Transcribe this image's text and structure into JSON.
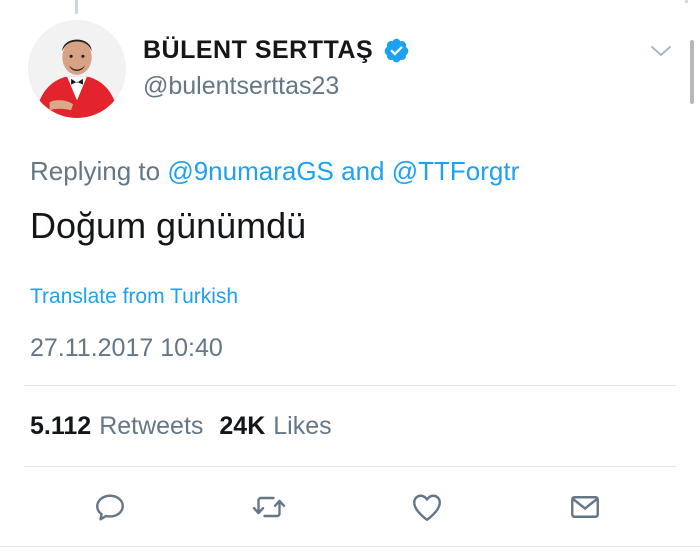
{
  "tweet": {
    "author": {
      "display_name": "BÜLENT SERTTAŞ",
      "handle": "@bulentserttas23",
      "verified": true,
      "avatar_icon": "profile-photo"
    },
    "replying_prefix": "Replying to",
    "reply_mentions": [
      "@9numaraGS",
      "@TTForgtr"
    ],
    "reply_joiner": "and",
    "text": "Doğum günümdü",
    "translate_label": "Translate from Turkish",
    "timestamp": "27.11.2017 10:40",
    "stats": {
      "retweets_count": "5.112",
      "retweets_label": "Retweets",
      "likes_count": "24K",
      "likes_label": "Likes"
    },
    "actions": [
      "reply-icon",
      "retweet-icon",
      "like-icon",
      "direct-message-icon"
    ]
  },
  "colors": {
    "accent": "#1da1f2",
    "secondary_text": "#657786",
    "primary_text": "#14171a",
    "divider": "#e1e8ed",
    "icon": "#657786"
  }
}
